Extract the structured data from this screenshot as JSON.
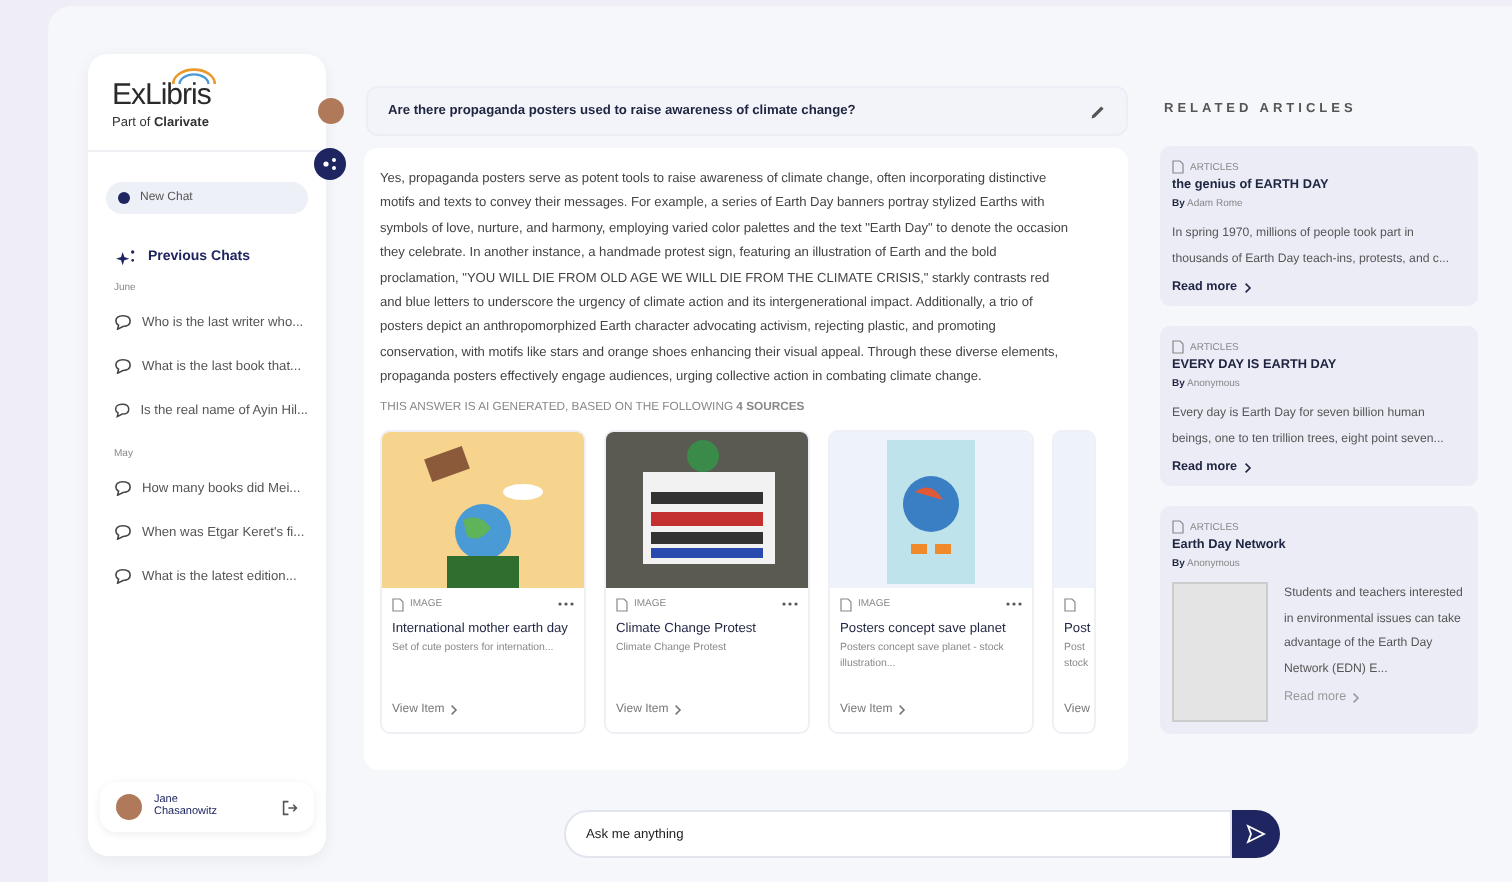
{
  "sidebar": {
    "logo": {
      "name": "ExLibris",
      "tagline": "Part of **Clarivate**"
    },
    "new_chat": "New Chat",
    "history_title": "Previous Chats",
    "groups": [
      {
        "label": "June",
        "items": [
          "Who is the last writer who...",
          "What is the last book that...",
          "Is the real name of Ayin Hil..."
        ]
      },
      {
        "label": "May",
        "items": [
          "How many books did Mei...",
          "When was Etgar Keret's fi...",
          "What is the latest edition..."
        ]
      }
    ],
    "user": {
      "name": "Jane Chasanowitz"
    }
  },
  "chat": {
    "question": "Are there propaganda posters used to raise awareness of climate change?",
    "answer": "Yes, propaganda posters serve as potent tools to raise awareness of climate change, often incorporating distinctive motifs and texts to convey their messages. For example, a series of Earth Day banners portray stylized Earths with symbols of love, nurture, and harmony, employing varied color palettes and the text \"Earth Day\" to denote the occasion they celebrate. In another instance, a handmade protest sign, featuring an illustration of Earth and the bold proclamation, \"YOU WILL DIE FROM OLD AGE WE WILL DIE FROM THE CLIMATE CRISIS,\" starkly contrasts red and blue letters to underscore the urgency of climate action and its intergenerational impact. Additionally, a trio of posters depict an anthropomorphized Earth character advocating activism, rejecting plastic, and promoting conservation, with motifs like stars and orange shoes enhancing their visual appeal. Through these diverse elements, propaganda posters effectively engage audiences, urging collective action in combating climate change.",
    "sources_note": "THIS ANSWER IS AI GENERATED, BASED ON THE FOLLOWING **4 SOURCES**",
    "sources": [
      {
        "kind": "watering",
        "type": "IMAGE",
        "title": "International mother earth day",
        "description": "Set of cute posters for internation...",
        "link": "View Item"
      },
      {
        "kind": "protest",
        "type": "IMAGE",
        "title": "Climate Change Protest",
        "description": "Climate Change Protest",
        "link": "View Item"
      },
      {
        "kind": "character",
        "type": "IMAGE",
        "title": "Posters concept save planet",
        "description": "Posters concept save planet - stock illustration...",
        "link": "View Item"
      },
      {
        "kind": "blank",
        "title": "Post",
        "description": "Post stock",
        "link": "View"
      }
    ],
    "input": {
      "placeholder": "Ask me anything"
    }
  },
  "related": {
    "title": "RELATED ARTICLES",
    "articles": [
      {
        "type": "ARTICLES",
        "title": "the genius of EARTH DAY",
        "by": "By",
        "author": "Adam Rome",
        "excerpt": "In spring 1970, millions of people took part in thousands of Earth Day teach-ins, protests, and c...",
        "link": "Read more",
        "thumbnail": false
      },
      {
        "type": "ARTICLES",
        "title": "EVERY DAY IS EARTH DAY",
        "by": "By",
        "author": "Anonymous",
        "excerpt": "Every day is Earth Day for seven billion human beings, one to ten trillion trees, eight point seven...",
        "link": "Read more",
        "thumbnail": false
      },
      {
        "type": "ARTICLES",
        "title": "Earth Day Network",
        "by": "By",
        "author": "Anonymous",
        "excerpt": "Students and teachers interested in environmental issues can take advantage of the Earth Day Network (EDN) E...",
        "link": "Read more",
        "thumbnail": true
      }
    ]
  }
}
